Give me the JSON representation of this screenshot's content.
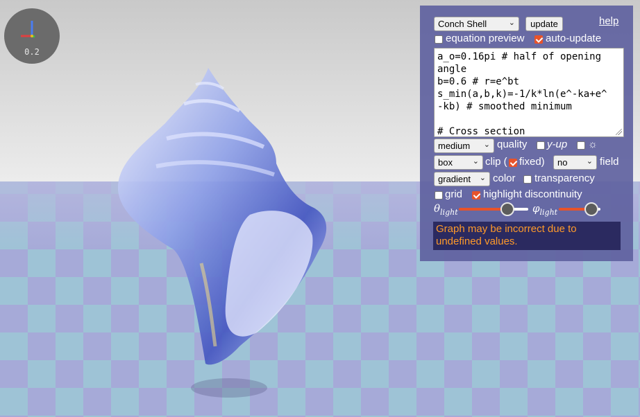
{
  "scene": {
    "floor_colors": [
      "#a6aad8",
      "#9ec3d6",
      "#a9a3d6"
    ],
    "sky_color": "#e6e6e6"
  },
  "axis_widget": {
    "scale_label": "0.2"
  },
  "panel": {
    "preset": {
      "value": "Conch Shell"
    },
    "update_label": "update",
    "help_label": "help",
    "equation_preview": {
      "label": "equation preview",
      "checked": false
    },
    "auto_update": {
      "label": "auto-update",
      "checked": true
    },
    "code_text": "a_o=0.16pi # half of opening\nangle\nb=0.6 # r=e^bt\ns_min(a,b,k)=-1/k*ln(e^-ka+e^\n-kb) # smoothed minimum\n\n# Cross section",
    "quality": {
      "value": "medium",
      "label": "quality"
    },
    "y_up": {
      "label": "y-up",
      "checked": false
    },
    "sun_toggle": {
      "icon": "sun-icon",
      "glyph": "☼",
      "checked": false
    },
    "clip": {
      "value": "box",
      "label_before": "clip (",
      "label_after": "fixed)",
      "fixed_checked": true
    },
    "field": {
      "value": "no",
      "label": "field"
    },
    "color": {
      "value": "gradient",
      "label": "color"
    },
    "transparency": {
      "label": "transparency",
      "checked": false
    },
    "grid": {
      "label": "grid",
      "checked": false
    },
    "highlight_discontinuity": {
      "label": "highlight discontinuity",
      "checked": true
    },
    "theta_light": {
      "symbol": "θ",
      "subscript": "light",
      "value_fraction": 0.7
    },
    "phi_light": {
      "symbol": "φ",
      "subscript": "light",
      "value_fraction": 0.78
    },
    "warning": "Graph may be incorrect due to undefined values.",
    "accent_color": "#e8532a"
  }
}
